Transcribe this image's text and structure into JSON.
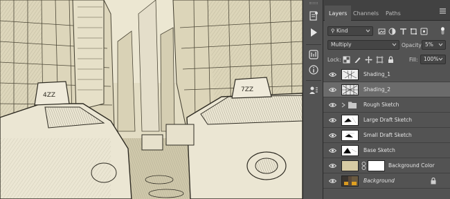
{
  "canvas": {
    "description_icon": "city-street-sketch-artwork"
  },
  "toolstrip": {
    "icons": [
      "history-icon",
      "play-icon",
      "adjustments-icon",
      "info-icon",
      "properties-icon"
    ]
  },
  "panel": {
    "tabs": [
      {
        "label": "Layers",
        "active": true
      },
      {
        "label": "Channels",
        "active": false
      },
      {
        "label": "Paths",
        "active": false
      }
    ],
    "filter_kind": "Kind",
    "blend_mode": "Multiply",
    "opacity_label": "Opacity:",
    "opacity_value": "5%",
    "lock_label": "Lock:",
    "fill_label": "Fill:",
    "fill_value": "100%"
  },
  "layers": [
    {
      "name": "Shading_1",
      "type": "pixel",
      "visible": true,
      "selected": false
    },
    {
      "name": "Shading_2",
      "type": "pixel",
      "visible": true,
      "selected": true
    },
    {
      "name": "Rough Sketch",
      "type": "group",
      "visible": true,
      "selected": false
    },
    {
      "name": "Large Draft Sketch",
      "type": "pixel",
      "visible": true,
      "selected": false
    },
    {
      "name": "Small Draft Sketch",
      "type": "pixel",
      "visible": true,
      "selected": false
    },
    {
      "name": "Base Sketch",
      "type": "pixel",
      "visible": true,
      "selected": false
    },
    {
      "name": "Background Color",
      "type": "fill",
      "visible": true,
      "selected": false
    },
    {
      "name": "Background",
      "type": "background",
      "visible": true,
      "selected": false,
      "locked": true
    }
  ],
  "colors": {
    "panel_bg": "#535353",
    "selected_row": "#6b6b6b",
    "fill_swatch": "#d7cba4",
    "canvas_paper": "#e2dcc2"
  }
}
